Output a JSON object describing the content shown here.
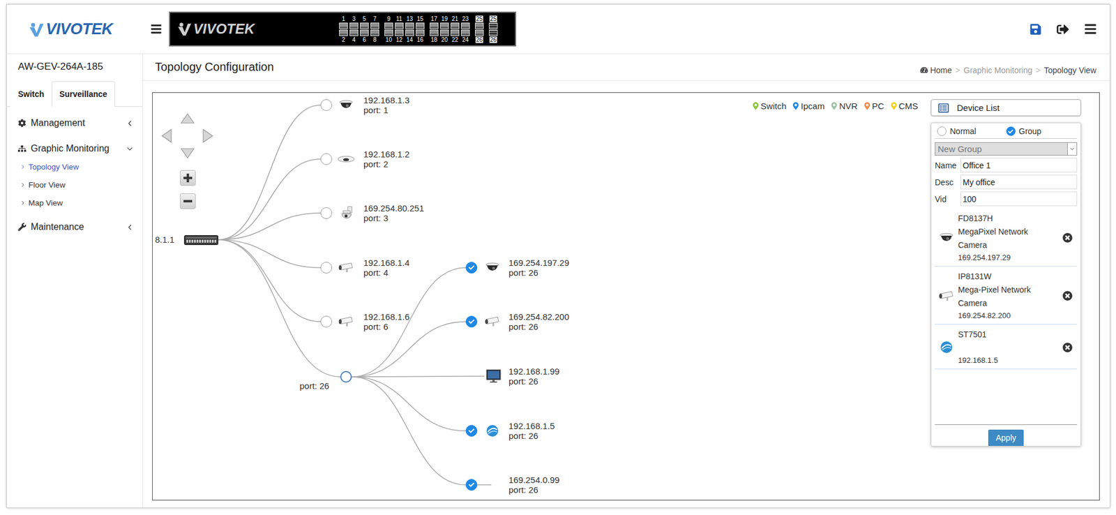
{
  "header": {
    "logo": "VIVOTEK"
  },
  "switch_panel": {
    "logo": "VIVOTEK",
    "port_groups": [
      [
        {
          "top": "1",
          "bottom": "2",
          "kind": "rj45"
        },
        {
          "top": "3",
          "bottom": "4",
          "kind": "rj45"
        },
        {
          "top": "5",
          "bottom": "6",
          "kind": "rj45"
        },
        {
          "top": "7",
          "bottom": "8",
          "kind": "rj45"
        }
      ],
      [
        {
          "top": "9",
          "bottom": "10",
          "kind": "rj45"
        },
        {
          "top": "11",
          "bottom": "12",
          "kind": "rj45"
        },
        {
          "top": "13",
          "bottom": "14",
          "kind": "rj45"
        },
        {
          "top": "15",
          "bottom": "16",
          "kind": "rj45"
        }
      ],
      [
        {
          "top": "17",
          "bottom": "18",
          "kind": "rj45"
        },
        {
          "top": "19",
          "bottom": "20",
          "kind": "rj45"
        },
        {
          "top": "21",
          "bottom": "22",
          "kind": "rj45"
        },
        {
          "top": "23",
          "bottom": "24",
          "kind": "rj45"
        }
      ],
      [
        {
          "top": "25",
          "bottom": "26",
          "kind": "combo"
        }
      ],
      [
        {
          "top": "25",
          "bottom": "26",
          "kind": "sfp"
        }
      ]
    ]
  },
  "sidebar": {
    "device_name": "AW-GEV-264A-185",
    "tabs": [
      {
        "label": "Switch",
        "selected": false
      },
      {
        "label": "Surveillance",
        "selected": true
      }
    ],
    "menu": [
      {
        "label": "Management",
        "icon": "gear",
        "expanded": false
      },
      {
        "label": "Graphic Monitoring",
        "icon": "sitemap",
        "expanded": true,
        "children": [
          {
            "label": "Topology View",
            "selected": true
          },
          {
            "label": "Floor View",
            "selected": false
          },
          {
            "label": "Map View",
            "selected": false
          }
        ]
      },
      {
        "label": "Maintenance",
        "icon": "wrench",
        "expanded": false
      }
    ]
  },
  "main": {
    "title": "Topology Configuration",
    "breadcrumb": {
      "separator": ">",
      "items": [
        {
          "label": "Home",
          "muted": false
        },
        {
          "label": "Graphic Monitoring",
          "muted": true
        },
        {
          "label": "Topology View",
          "muted": false
        }
      ]
    }
  },
  "topology": {
    "legend": [
      {
        "label": "Switch",
        "color": "#8cc63e"
      },
      {
        "label": "Ipcam",
        "color": "#1e88e5"
      },
      {
        "label": "NVR",
        "color": "#9cc3a8"
      },
      {
        "label": "PC",
        "color": "#f08a4b"
      },
      {
        "label": "CMS",
        "color": "#f3d31b"
      }
    ],
    "root": {
      "label": "8.1.1"
    },
    "nodes": [
      {
        "ip": "192.168.1.3",
        "port": "port: 1",
        "checked": false,
        "kind": "dome"
      },
      {
        "ip": "192.168.1.2",
        "port": "port: 2",
        "checked": false,
        "kind": "fisheye"
      },
      {
        "ip": "169.254.80.251",
        "port": "port: 3",
        "checked": false,
        "kind": "ptz"
      },
      {
        "ip": "192.168.1.4",
        "port": "port: 4",
        "checked": false,
        "kind": "bullet"
      },
      {
        "ip": "192.168.1.6",
        "port": "port: 6",
        "checked": false,
        "kind": "bullet"
      }
    ],
    "hub": {
      "label": "port: 26",
      "expanded": true,
      "children": [
        {
          "ip": "169.254.197.29",
          "port": "port: 26",
          "checked": true,
          "kind": "dome"
        },
        {
          "ip": "169.254.82.200",
          "port": "port: 26",
          "checked": true,
          "kind": "bullet"
        },
        {
          "ip": "192.168.1.99",
          "port": "port: 26",
          "checked": false,
          "kind": "monitor"
        },
        {
          "ip": "192.168.1.5",
          "port": "port: 26",
          "checked": true,
          "kind": "st"
        },
        {
          "ip": "169.254.0.99",
          "port": "port: 26",
          "checked": true,
          "kind": "none"
        }
      ]
    }
  },
  "device_list": {
    "title": "Device List",
    "modes": [
      {
        "label": "Normal",
        "selected": false
      },
      {
        "label": "Group",
        "selected": true
      }
    ],
    "group_select": "New Group",
    "fields": [
      {
        "label": "Name",
        "value": "Office 1"
      },
      {
        "label": "Desc",
        "value": "My office"
      },
      {
        "label": "Vid",
        "value": "100"
      }
    ],
    "devices": [
      {
        "model": "FD8137H",
        "desc": "MegaPixel Network Camera",
        "ip": "169.254.197.29",
        "kind": "dome"
      },
      {
        "model": "IP8131W",
        "desc": "Mega-Pixel Network Camera",
        "ip": "169.254.82.200",
        "kind": "bullet"
      },
      {
        "model": "ST7501",
        "desc": "",
        "ip": "192.168.1.5",
        "kind": "st"
      }
    ],
    "apply": "Apply"
  }
}
